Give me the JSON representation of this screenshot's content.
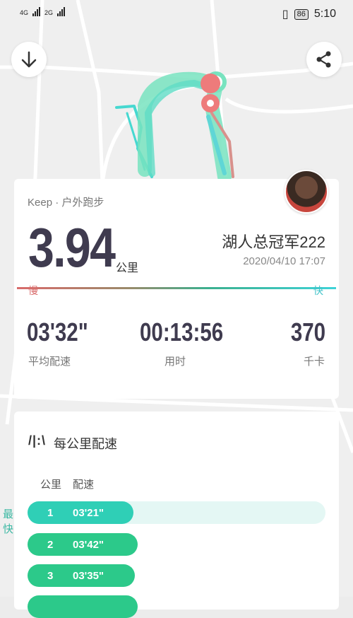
{
  "status_bar": {
    "net1": "4G",
    "net2": "2G",
    "battery": "86",
    "time": "5:10",
    "vibrate_icon": "vibrate-icon"
  },
  "top_actions": {
    "download_icon": "arrow-down-icon",
    "share_icon": "share-icon"
  },
  "summary": {
    "source": "Keep · 户外跑步",
    "distance": "3.94",
    "distance_unit": "公里",
    "username": "湖人总冠军222",
    "datetime": "2020/04/10 17:07",
    "slow_label": "慢",
    "fast_label": "快",
    "stats": [
      {
        "value": "03'32\"",
        "label": "平均配速"
      },
      {
        "value": "00:13:56",
        "label": "用时"
      },
      {
        "value": "370",
        "label": "千卡"
      }
    ]
  },
  "pace_section": {
    "icon": "pace-bars-icon",
    "title": "每公里配速",
    "col_km": "公里",
    "col_pace": "配速",
    "fastest_tag": "最快",
    "rows": [
      {
        "km": "1",
        "pace": "03'21\"",
        "fraction": 0.355,
        "color": "#2fcfb6"
      },
      {
        "km": "2",
        "pace": "03'42\"",
        "fraction": 0.37,
        "color": "#2cc98a"
      },
      {
        "km": "3",
        "pace": "03'35\"",
        "fraction": 0.36,
        "color": "#2cc98a"
      }
    ]
  },
  "colors": {
    "accent_teal": "#2fcfb6",
    "accent_green": "#2cc98a",
    "slow_red": "#d96b6b",
    "fast_cyan": "#3fd3d8"
  }
}
